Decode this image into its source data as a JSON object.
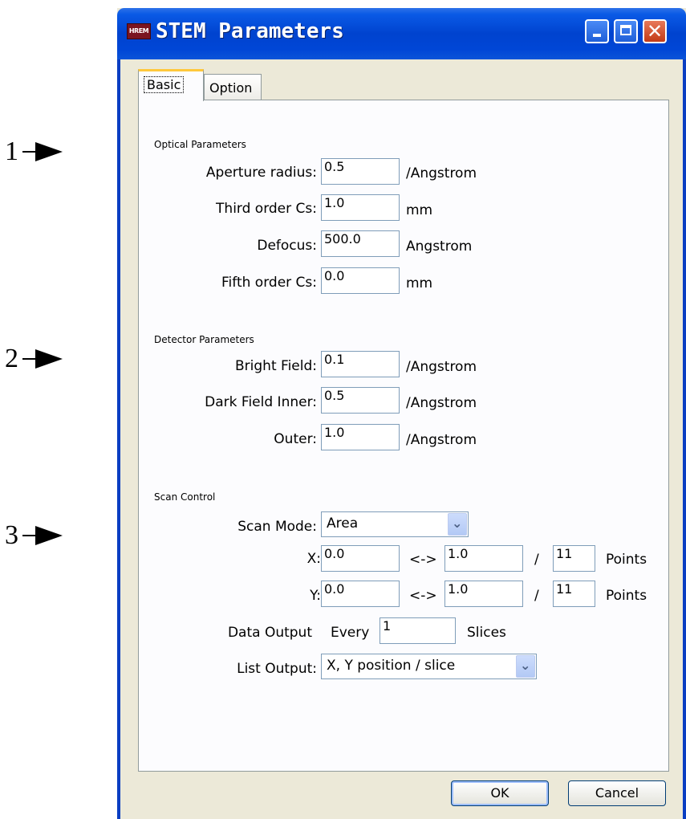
{
  "annotations": {
    "markers": [
      "1",
      "2",
      "3"
    ]
  },
  "window": {
    "title": "STEM Parameters",
    "icon_label": "HREM"
  },
  "tabs": [
    {
      "label": "Basic",
      "active": true
    },
    {
      "label": "Option",
      "active": false
    }
  ],
  "optical": {
    "title": "Optical Parameters",
    "aperture_radius": {
      "label": "Aperture radius:",
      "value": "0.5",
      "unit": "/Angstrom"
    },
    "third_order_cs": {
      "label": "Third order Cs:",
      "value": "1.0",
      "unit": "mm"
    },
    "defocus": {
      "label": "Defocus:",
      "value": "500.0",
      "unit": "Angstrom"
    },
    "fifth_order_cs": {
      "label": "Fifth order Cs:",
      "value": "0.0",
      "unit": "mm"
    }
  },
  "detector": {
    "title": "Detector Parameters",
    "bright_field": {
      "label": "Bright Field:",
      "value": "0.1",
      "unit": "/Angstrom"
    },
    "dark_field_inner": {
      "label": "Dark Field Inner:",
      "value": "0.5",
      "unit": "/Angstrom"
    },
    "outer": {
      "label": "Outer:",
      "value": "1.0",
      "unit": "/Angstrom"
    }
  },
  "scan": {
    "title": "Scan Control",
    "mode_label": "Scan Mode:",
    "mode_value": "Area",
    "x": {
      "label": "X:",
      "from": "0.0",
      "arrow": "<->",
      "to": "1.0",
      "slash": "/",
      "points": "11",
      "points_label": "Points"
    },
    "y": {
      "label": "Y:",
      "from": "0.0",
      "arrow": "<->",
      "to": "1.0",
      "slash": "/",
      "points": "11",
      "points_label": "Points"
    },
    "data_output_label": "Data Output",
    "every_label": "Every",
    "every_value": "1",
    "slices_label": "Slices",
    "list_output_label": "List Output:",
    "list_output_value": "X, Y position / slice"
  },
  "buttons": {
    "ok": "OK",
    "cancel": "Cancel"
  }
}
